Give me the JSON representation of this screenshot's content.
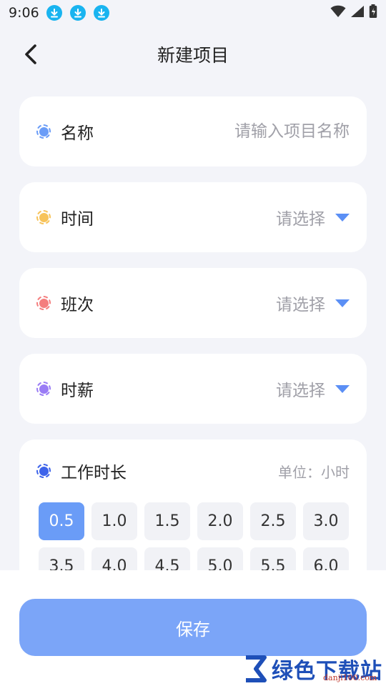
{
  "status_bar": {
    "time": "9:06",
    "download_icons": [
      "download-icon",
      "download-icon",
      "download-icon"
    ],
    "right_icons": [
      "wifi-icon",
      "signal-icon",
      "battery-icon"
    ]
  },
  "header": {
    "back_icon": "chevron-left-icon",
    "title": "新建项目"
  },
  "form": {
    "name": {
      "label": "名称",
      "placeholder": "请输入项目名称",
      "value": "",
      "dot_color": "#6a9cf7"
    },
    "time": {
      "label": "时间",
      "value": "请选择",
      "dot_color": "#f7c35a"
    },
    "shift": {
      "label": "班次",
      "value": "请选择",
      "dot_color": "#f47e7e"
    },
    "wage": {
      "label": "时薪",
      "value": "请选择",
      "dot_color": "#9a7cf5"
    },
    "duration": {
      "label": "工作时长",
      "unit": "单位：小时",
      "dot_color": "#3d63ea",
      "selected": "0.5",
      "options": [
        "0.5",
        "1.0",
        "1.5",
        "2.0",
        "2.5",
        "3.0",
        "3.5",
        "4.0",
        "4.5",
        "5.0",
        "5.5",
        "6.0"
      ]
    }
  },
  "footer": {
    "save_label": "保存"
  },
  "watermark": {
    "text": "绿色下载站",
    "domain": "danji100.com"
  }
}
